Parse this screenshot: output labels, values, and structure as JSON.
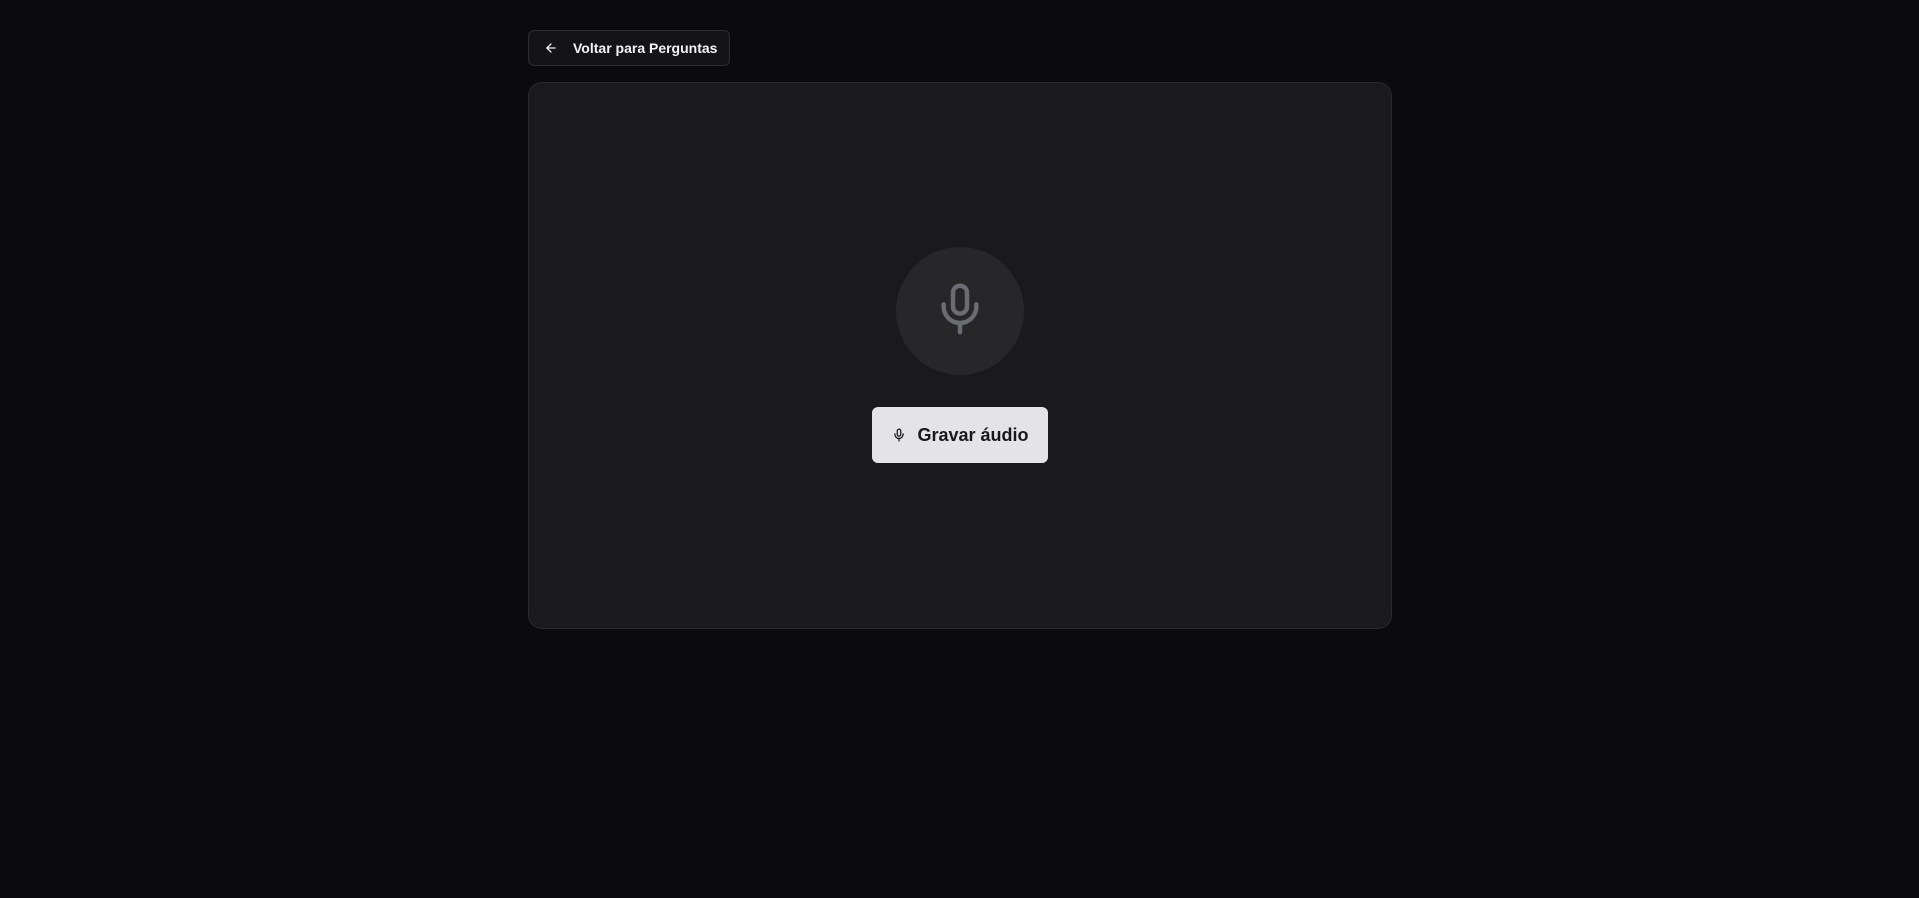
{
  "header": {
    "back_label": "Voltar para Perguntas",
    "back_icon": "arrow-left-icon"
  },
  "recorder": {
    "mic_icon": "microphone-icon",
    "record_label": "Gravar áudio",
    "record_icon": "microphone-icon"
  },
  "colors": {
    "background": "#0b0b0d",
    "card": "#1a1a1d",
    "mic_circle": "#27272a",
    "mic_icon": "#6b6b72",
    "button_bg": "#e4e4e7",
    "button_text": "#18181b"
  }
}
